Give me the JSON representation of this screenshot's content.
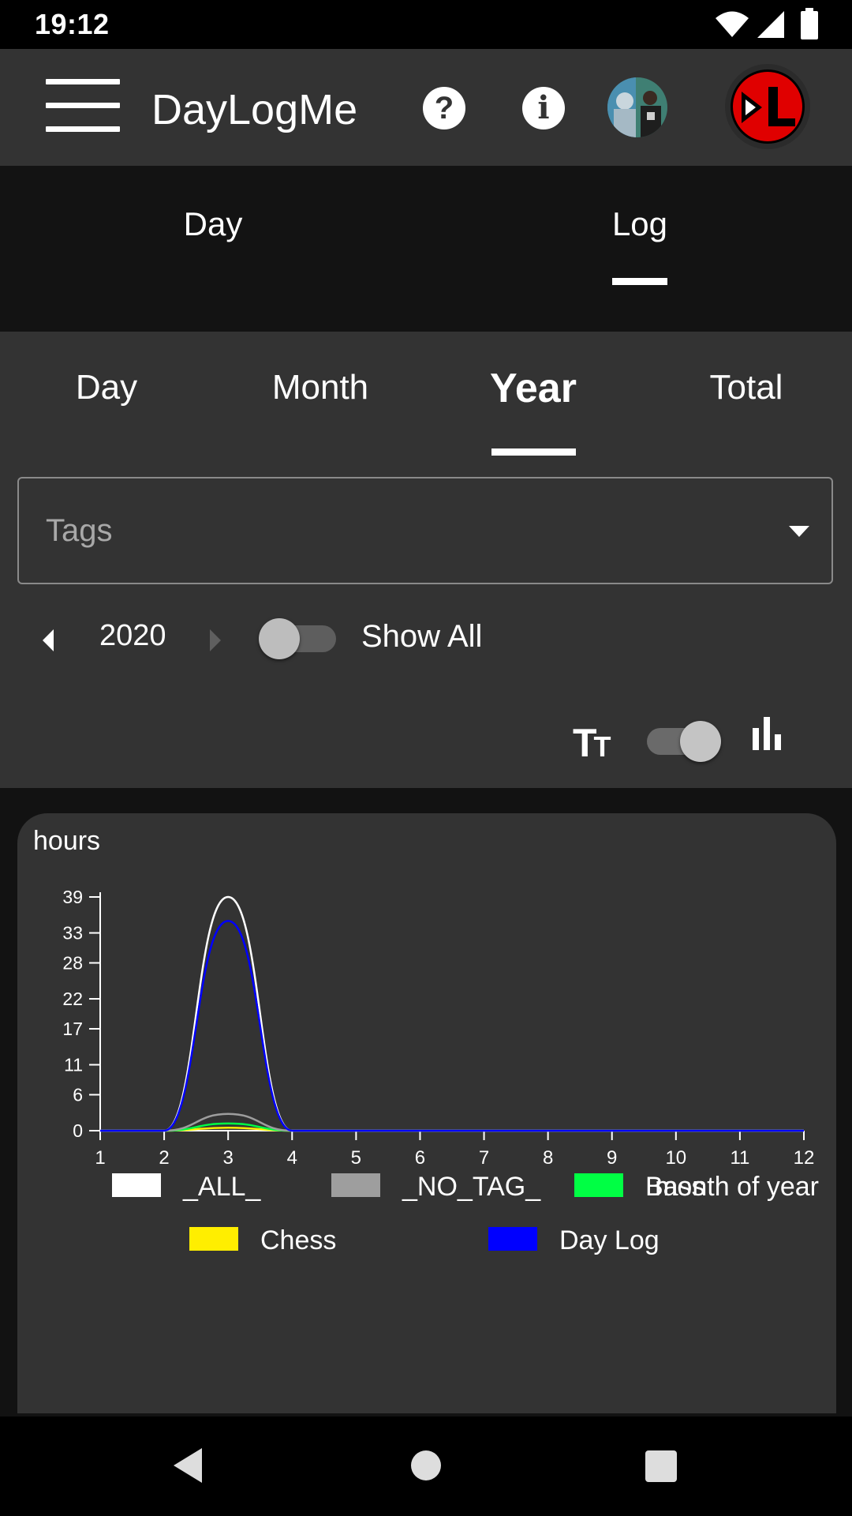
{
  "status_bar": {
    "time": "19:12"
  },
  "app_bar": {
    "title": "DayLogMe"
  },
  "top_tabs": {
    "items": [
      "Day",
      "Log"
    ],
    "selected": "Log"
  },
  "sub_tabs": {
    "items": [
      "Day",
      "Month",
      "Year",
      "Total"
    ],
    "selected": "Year"
  },
  "tags_field": {
    "placeholder": "Tags"
  },
  "year_nav": {
    "year": "2020",
    "show_all_label": "Show All",
    "show_all_on": false
  },
  "chart_toggle": {
    "bar_mode_on": true
  },
  "icons": {
    "menu": "menu-icon",
    "help": "help-icon",
    "info": "info-icon",
    "avatar": "avatar",
    "logo": "daylogme-logo",
    "text_size": "text-size-icon",
    "bar_chart": "bar-chart-icon"
  },
  "chart_data": {
    "type": "line",
    "ylabel": "hours",
    "xlabel": "month of year",
    "x": [
      1,
      2,
      3,
      4,
      5,
      6,
      7,
      8,
      9,
      10,
      11,
      12
    ],
    "y_ticks": [
      0,
      6,
      11,
      17,
      22,
      28,
      33,
      39
    ],
    "ylim": [
      0,
      39
    ],
    "xlim": [
      1,
      12
    ],
    "series": [
      {
        "name": "_ALL_",
        "color": "#ffffff",
        "values": [
          0,
          0,
          39,
          0,
          0,
          0,
          0,
          0,
          0,
          0,
          0,
          0
        ]
      },
      {
        "name": "_NO_TAG_",
        "color": "#9e9e9e",
        "values": [
          0,
          0,
          2.8,
          0,
          0,
          0,
          0,
          0,
          0,
          0,
          0,
          0
        ]
      },
      {
        "name": "Bass",
        "color": "#00ff44",
        "values": [
          0,
          0,
          1.2,
          0,
          0,
          0,
          0,
          0,
          0,
          0,
          0,
          0
        ]
      },
      {
        "name": "Chess",
        "color": "#ffee00",
        "values": [
          0,
          0,
          0.5,
          0,
          0,
          0,
          0,
          0,
          0,
          0,
          0,
          0
        ]
      },
      {
        "name": "Day Log",
        "color": "#0000ff",
        "values": [
          0,
          0,
          35,
          0,
          0,
          0,
          0,
          0,
          0,
          0,
          0,
          0
        ]
      }
    ]
  }
}
